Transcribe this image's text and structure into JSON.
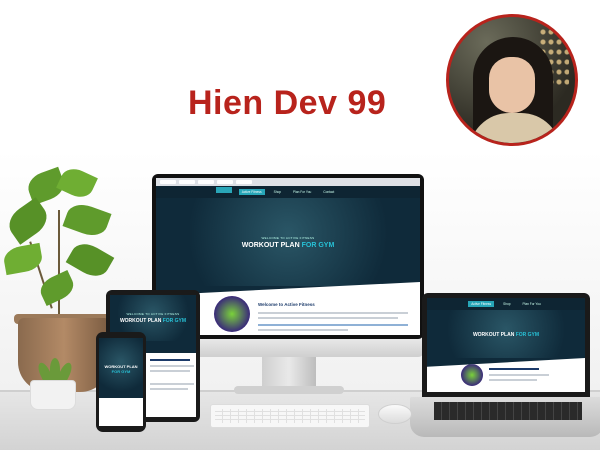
{
  "header": {
    "title": "Hien Dev 99"
  },
  "colors": {
    "accent": "#b8231c",
    "site_dark": "#0f2a3a",
    "site_teal": "#27c1d6"
  },
  "website": {
    "nav_items": [
      "Active Fitness",
      "Shop",
      "Plan For You",
      "Contact"
    ],
    "hero_subtitle": "WELCOME TO ACTIVE FITNESS",
    "hero_title_main": "WORKOUT PLAN",
    "hero_title_accent": "FOR GYM",
    "intro_heading": "Welcome to Active Fitness"
  },
  "icons": [
    "avatar-photo",
    "plant-decoration",
    "keyboard",
    "mouse"
  ]
}
